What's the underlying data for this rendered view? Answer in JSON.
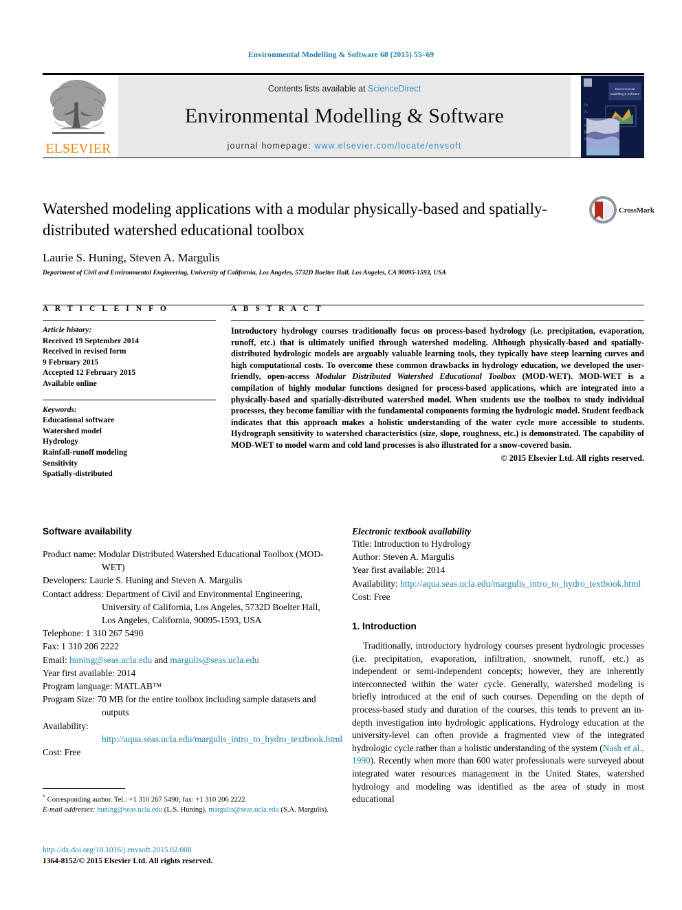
{
  "running_head": "Environmental Modelling & Software 68 (2015) 55–69",
  "masthead": {
    "contents_prefix": "Contents lists available at ",
    "sciencedirect": "ScienceDirect",
    "journal_title": "Environmental Modelling & Software",
    "homepage_prefix": "journal homepage: ",
    "homepage_url": "www.elsevier.com/locate/envsoft",
    "publisher": "ELSEVIER",
    "cover_label": "Environmental Modelling & Software"
  },
  "crossmark": {
    "label": "CrossMark"
  },
  "article": {
    "title": "Watershed modeling applications with a modular physically-based and spatially-distributed watershed educational toolbox",
    "authors": "Laurie S. Huning, Steven A. Margulis",
    "corresponding_marker": "*",
    "affiliation": "Department of Civil and Environmental Engineering, University of California, Los Angeles, 5732D Boelter Hall, Los Angeles, CA 90095-1593, USA"
  },
  "article_info": {
    "heading": "A R T I C L E   I N F O",
    "history_label": "Article history:",
    "history": [
      "Received 19 September 2014",
      "Received in revised form",
      "9 February 2015",
      "Accepted 12 February 2015",
      "Available online"
    ],
    "keywords_label": "Keywords:",
    "keywords": [
      "Educational software",
      "Watershed model",
      "Hydrology",
      "Rainfall-runoff modeling",
      "Sensitivity",
      "Spatially-distributed"
    ]
  },
  "abstract": {
    "heading": "A B S T R A C T",
    "part1": "Introductory hydrology courses traditionally focus on process-based hydrology (i.e. precipitation, evaporation, runoff, etc.) that is ultimately unified through watershed modeling. Although physically-based and spatially-distributed hydrologic models are arguably valuable learning tools, they typically have steep learning curves and high computational costs. To overcome these common drawbacks in hydrology education, we developed the user-friendly, open-access ",
    "emphasis": "Modular Distributed Watershed Educational Toolbox",
    "part2": " (MOD-WET). MOD-WET is a compilation of highly modular functions designed for process-based applications, which are integrated into a physically-based and spatially-distributed watershed model. When students use the toolbox to study individual processes, they become familiar with the fundamental components forming the hydrologic model. Student feedback indicates that this approach makes a holistic understanding of the water cycle more accessible to students. Hydrograph sensitivity to watershed characteristics (size, slope, roughness, etc.) is demonstrated. The capability of MOD-WET to model warm and cold land processes is also illustrated for a snow-covered basin.",
    "copyright": "© 2015 Elsevier Ltd. All rights reserved."
  },
  "software_availability": {
    "heading": "Software availability",
    "items": [
      {
        "label": "Product name:",
        "value": "Modular Distributed Watershed Educational Toolbox (MOD-WET)"
      },
      {
        "label": "Developers:",
        "value": "Laurie S. Huning and Steven A. Margulis"
      },
      {
        "label": "Contact address:",
        "value": "Department of Civil and Environmental Engineering, University of California, Los Angeles, 5732D Boelter Hall, Los Angeles, California, 90095-1593, USA"
      },
      {
        "label": "Telephone:",
        "value": "1 310 267 5490"
      },
      {
        "label": "Fax:",
        "value": "1 310 206 2222"
      },
      {
        "label": "Year first available:",
        "value": "2014"
      },
      {
        "label": "Program language:",
        "value": "MATLAB™"
      },
      {
        "label": "Program Size:",
        "value": "70 MB for the entire toolbox including sample datasets and outputs"
      },
      {
        "label": "Cost:",
        "value": "Free"
      }
    ],
    "email_label": "Email:",
    "email_1": "huning@seas.ucla.edu",
    "email_conj": " and ",
    "email_2": "margulis@seas.ucla.edu",
    "availability_label": "Availability:",
    "availability_url": "http://aqua.seas.ucla.edu/margulis_intro_to_hydro_textbook.html"
  },
  "textbook_availability": {
    "heading": "Electronic textbook availability",
    "items": [
      {
        "label": "Title:",
        "value": "Introduction to Hydrology"
      },
      {
        "label": "Author:",
        "value": "Steven A. Margulis"
      },
      {
        "label": "Year first available:",
        "value": "2014"
      },
      {
        "label": "Cost:",
        "value": "Free"
      }
    ],
    "availability_label": "Availability:",
    "availability_url": "http://aqua.seas.ucla.edu/margulis_intro_to_hydro_textbook.html"
  },
  "introduction": {
    "heading": "1.  Introduction",
    "para_before_cite": "Traditionally, introductory hydrology courses present hydrologic processes (i.e. precipitation, evaporation, infiltration, snowmelt, runoff, etc.) as independent or semi-independent concepts; however, they are inherently interconnected within the water cycle. Generally, watershed modeling is briefly introduced at the end of such courses. Depending on the depth of process-based study and duration of the courses, this tends to prevent an in-depth investigation into hydrologic applications. Hydrology education at the university-level can often provide a fragmented view of the integrated hydrologic cycle rather than a holistic understanding of the system (",
    "citation": "Nash et al., 1990",
    "para_after_cite": "). Recently when more than 600 water professionals were surveyed about integrated water resources management in the United States, watershed hydrology and modeling was identified as the area of study in most educational"
  },
  "footnotes": {
    "corresponding": "Corresponding author. Tel.: +1 310 267 5490; fax: +1 310 206 2222.",
    "email_label": "E-mail addresses:",
    "email_1": "huning@seas.ucla.edu",
    "email_1_owner": " (L.S. Huning), ",
    "email_2": "margulis@seas.ucla.edu",
    "email_2_owner": " (S.A. Margulis).",
    "doi": "http://dx.doi.org/10.1016/j.envsoft.2015.02.008",
    "issn": "1364-8152/© 2015 Elsevier Ltd. All rights reserved."
  },
  "colors": {
    "link": "#1b7fb5",
    "masthead_link": "#3f8fc0",
    "elsevier_orange": "#ef8200",
    "cover_navy": "#0d1a44",
    "crossmark_red": "#b5281e"
  }
}
